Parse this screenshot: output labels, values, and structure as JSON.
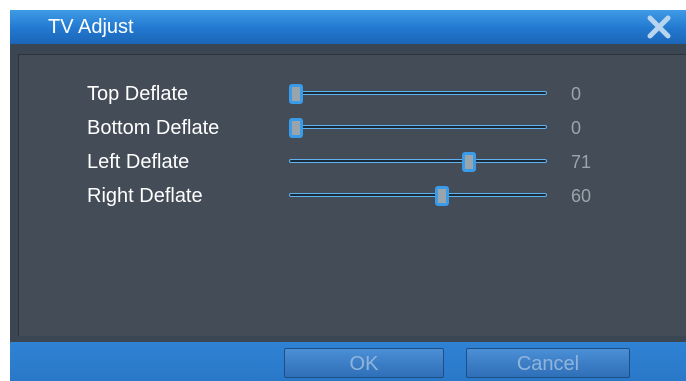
{
  "dialog": {
    "title": "TV Adjust",
    "close_icon": "close-icon"
  },
  "settings": [
    {
      "label": "Top Deflate",
      "value": "0",
      "level": 0,
      "max": 100
    },
    {
      "label": "Bottom Deflate",
      "value": "0",
      "level": 0,
      "max": 100
    },
    {
      "label": "Left Deflate",
      "value": "71",
      "level": 71,
      "max": 100
    },
    {
      "label": "Right Deflate",
      "value": "60",
      "level": 60,
      "max": 100
    }
  ],
  "buttons": {
    "ok_label": "OK",
    "cancel_label": "Cancel"
  },
  "colors": {
    "title_bar": "#2278cf",
    "panel": "#434c57",
    "accent": "#3a9be8"
  }
}
